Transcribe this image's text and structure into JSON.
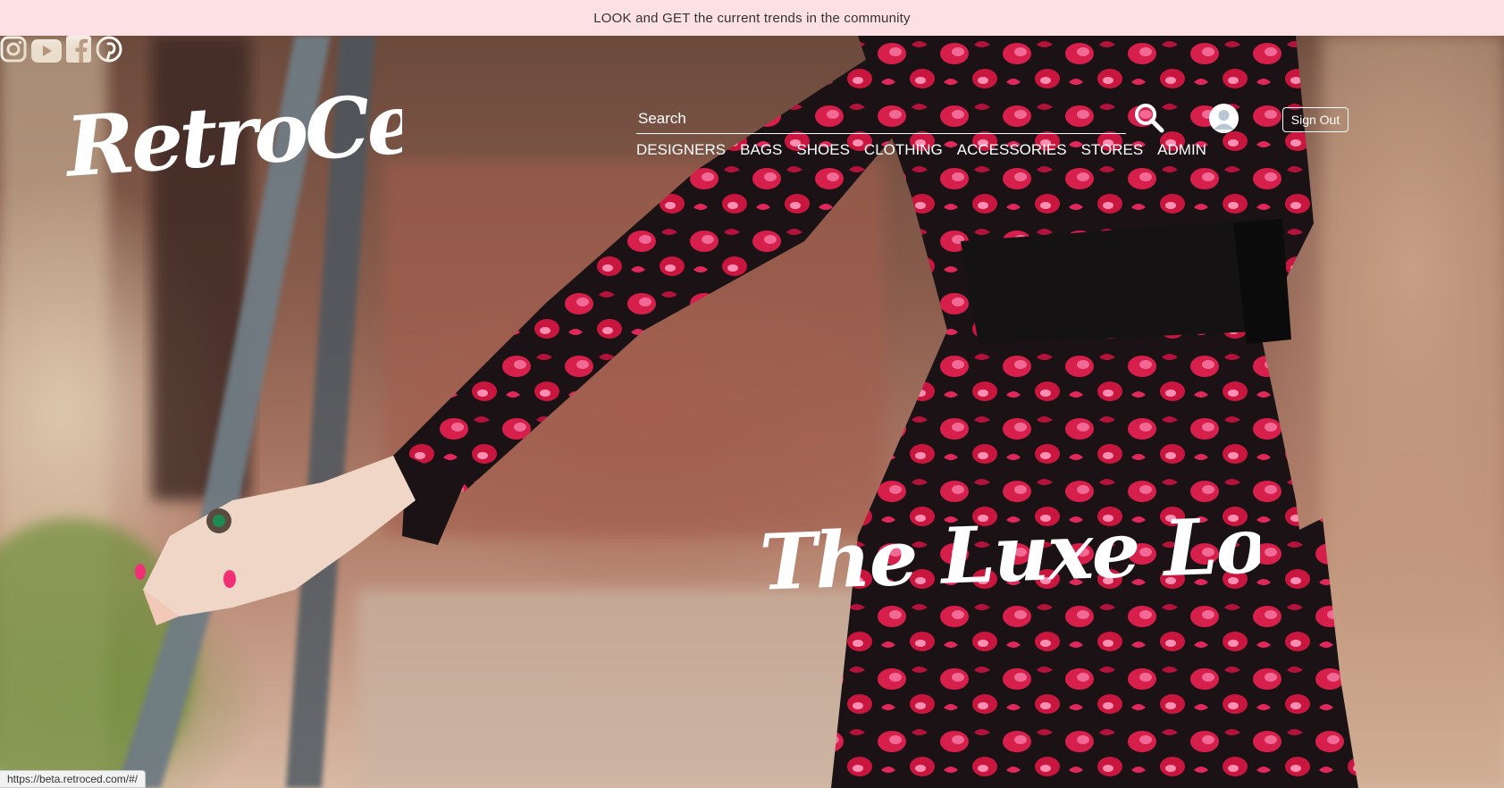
{
  "promo": {
    "text": "LOOK and GET the current trends in the community"
  },
  "brand": {
    "logo_text": "RetroCed"
  },
  "search": {
    "placeholder": "Search"
  },
  "nav": {
    "items": [
      {
        "label": "DESIGNERS"
      },
      {
        "label": "BAGS"
      },
      {
        "label": "SHOES"
      },
      {
        "label": "CLOTHING"
      },
      {
        "label": "ACCESSORIES"
      },
      {
        "label": "STORES"
      },
      {
        "label": "ADMIN"
      }
    ]
  },
  "account": {
    "signout_label": "Sign Out"
  },
  "hero": {
    "headline": "The Luxe Look",
    "slide_count": 4,
    "active_slide": 1
  },
  "social": {
    "icons": [
      "instagram-icon",
      "youtube-icon",
      "facebook-icon",
      "pinterest-icon"
    ]
  },
  "status_bar": {
    "url": "https://beta.retroced.com/#/"
  },
  "colors": {
    "promo_bg": "#fde0e4",
    "accent_red": "#d61f4a",
    "text_light": "#ffffff"
  }
}
